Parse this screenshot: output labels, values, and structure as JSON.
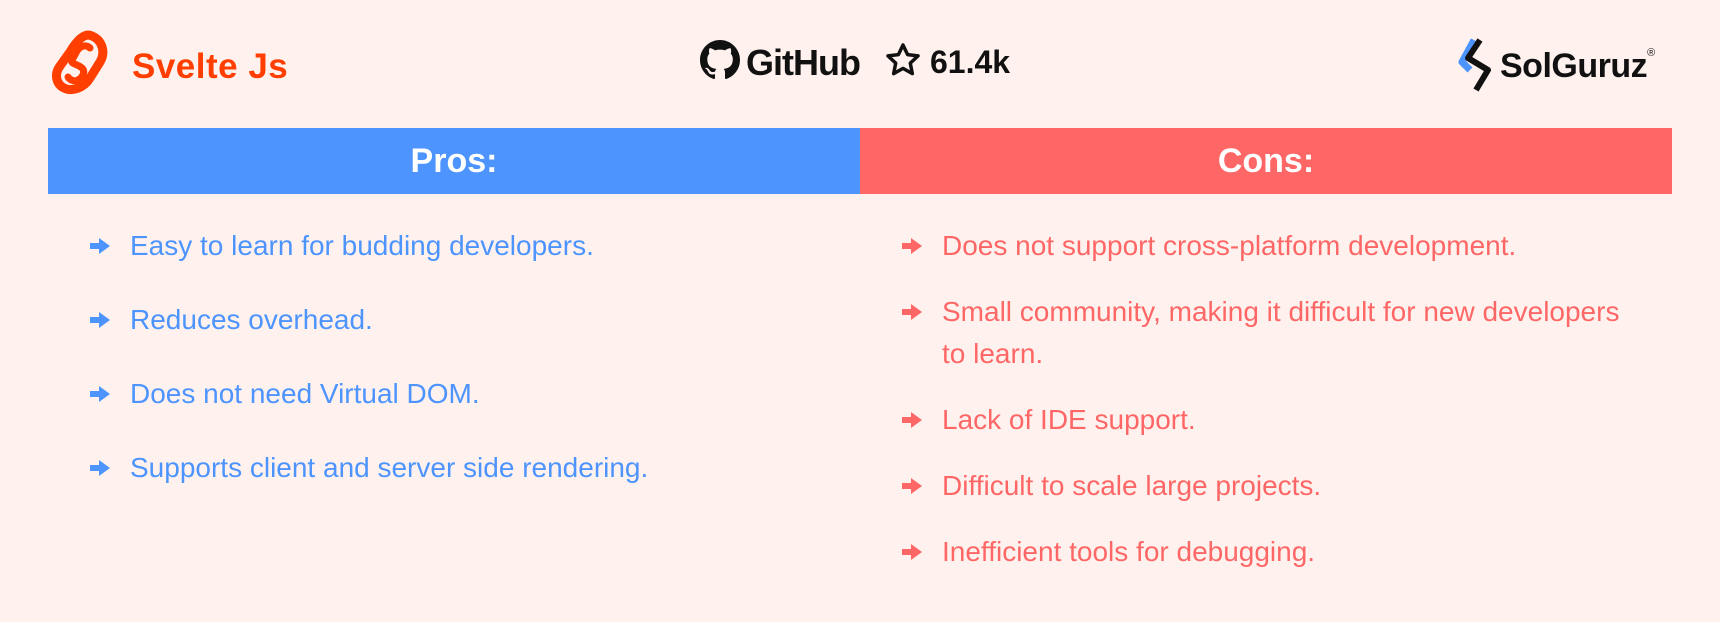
{
  "header": {
    "brand_name": "Svelte Js",
    "github_label": "GitHub",
    "github_stars": "61.4k",
    "company_name": "SolGuruz",
    "company_registered_mark": "®"
  },
  "colors": {
    "svelte_orange": "#ff3e00",
    "pros_blue": "#4d94ff",
    "cons_red": "#ff6767",
    "background": "#fff2ee"
  },
  "pros": {
    "title": "Pros:",
    "items": [
      "Easy to learn for budding developers.",
      "Reduces overhead.",
      "Does not need Virtual DOM.",
      "Supports client and server side rendering."
    ]
  },
  "cons": {
    "title": "Cons:",
    "items": [
      "Does not support cross-platform development.",
      "Small community, making it difficult for new developers to learn.",
      "Lack of IDE support.",
      "Difficult to scale large projects.",
      "Inefficient tools for debugging."
    ]
  }
}
